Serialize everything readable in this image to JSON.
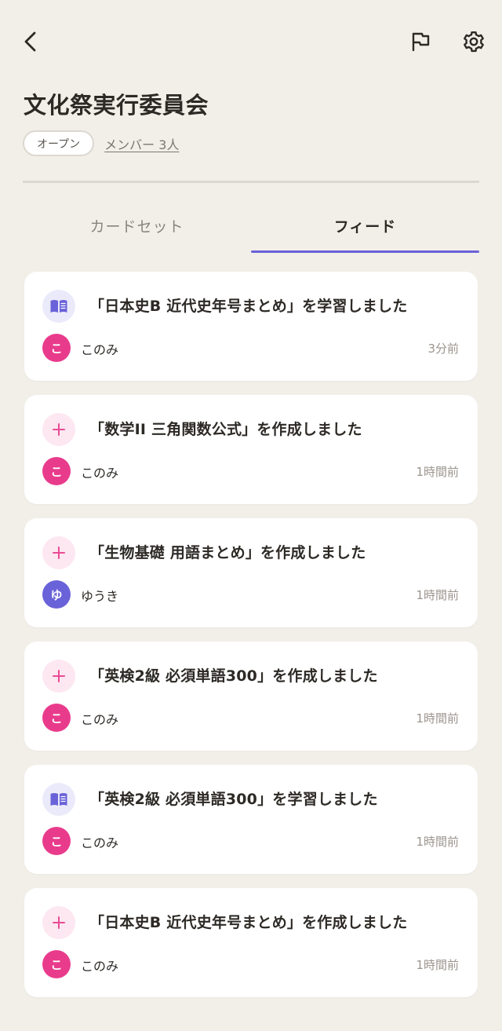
{
  "header": {
    "back_icon": "back-arrow-icon",
    "flag_icon": "flag-icon",
    "settings_icon": "gear-icon"
  },
  "group": {
    "title": "文化祭実行委員会",
    "visibility": "オープン",
    "members": "メンバー 3人"
  },
  "tabs": [
    {
      "label": "カードセット",
      "active": false
    },
    {
      "label": "フィード",
      "active": true
    }
  ],
  "colors": {
    "accent": "#6a62d8",
    "avatar_konomi": "#e93b8c",
    "avatar_yuki": "#6a62d8",
    "study_icon": "#6a62d8",
    "create_icon": "#ea4c95"
  },
  "feed": [
    {
      "type": "study",
      "icon": "book-icon",
      "text": "「日本史B 近代史年号まとめ」を学習しました",
      "user": "このみ",
      "initial": "こ",
      "avatar_color": "#e93b8c",
      "time": "3分前"
    },
    {
      "type": "create",
      "icon": "plus-icon",
      "text": "「数学II 三角関数公式」を作成しました",
      "user": "このみ",
      "initial": "こ",
      "avatar_color": "#e93b8c",
      "time": "1時間前"
    },
    {
      "type": "create",
      "icon": "plus-icon",
      "text": "「生物基礎 用語まとめ」を作成しました",
      "user": "ゆうき",
      "initial": "ゆ",
      "avatar_color": "#6a62d8",
      "time": "1時間前"
    },
    {
      "type": "create",
      "icon": "plus-icon",
      "text": "「英検2級 必須単語300」を作成しました",
      "user": "このみ",
      "initial": "こ",
      "avatar_color": "#e93b8c",
      "time": "1時間前"
    },
    {
      "type": "study",
      "icon": "book-icon",
      "text": "「英検2級 必須単語300」を学習しました",
      "user": "このみ",
      "initial": "こ",
      "avatar_color": "#e93b8c",
      "time": "1時間前"
    },
    {
      "type": "create",
      "icon": "plus-icon",
      "text": "「日本史B 近代史年号まとめ」を作成しました",
      "user": "このみ",
      "initial": "こ",
      "avatar_color": "#e93b8c",
      "time": "1時間前"
    }
  ]
}
